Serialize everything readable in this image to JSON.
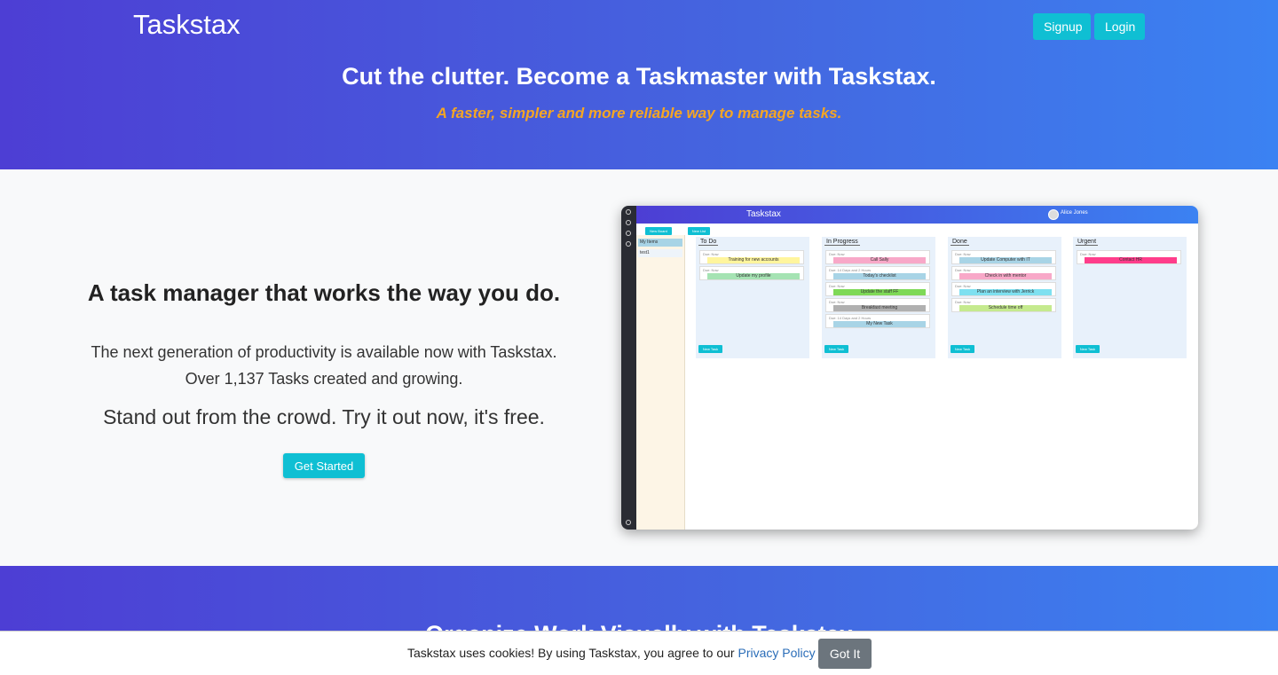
{
  "header": {
    "brand": "Taskstax",
    "signup_label": "Signup",
    "login_label": "Login",
    "title": "Cut the clutter. Become a Taskmaster with Taskstax.",
    "subtitle": "A faster, simpler and more reliable way to manage tasks.",
    "subtitle_color": "#f5a623",
    "accent": "#0fbfd3"
  },
  "feature": {
    "title": "A task manager that works the way you do.",
    "line1": "The next generation of productivity is available now with Taskstax.",
    "line2": "Over 1,137 Tasks created and growing.",
    "line3": "Stand out from the crowd. Try it out now, it's free.",
    "cta_label": "Get Started"
  },
  "preview": {
    "title": "Taskstax",
    "user": "Alice Jones",
    "new_board": "New Board",
    "new_list": "New List",
    "sidebar": [
      "My Items",
      "test1"
    ],
    "columns": [
      {
        "title": "To Do",
        "cards": [
          {
            "due": "Due: Now",
            "text": "Training for new accounts",
            "color": "#fff59d"
          },
          {
            "due": "Due: Now",
            "text": "Update my profile",
            "color": "#a5e3b3"
          }
        ]
      },
      {
        "title": "In Progress",
        "cards": [
          {
            "due": "Due: Now",
            "text": "Call Sally",
            "color": "#f8a8c8"
          },
          {
            "due": "Due: 14 Days and 2 Hours",
            "text": "Today's checklist",
            "color": "#a8d4e6"
          },
          {
            "due": "Due: Now",
            "text": "Update the staff FF",
            "color": "#7ed957"
          },
          {
            "due": "Due: Now",
            "text": "Breakfast meeting",
            "color": "#b0b0b0"
          },
          {
            "due": "Due: 14 Days and 2 Hours",
            "text": "My New Task",
            "color": "#a8d4e6"
          }
        ]
      },
      {
        "title": "Done",
        "cards": [
          {
            "due": "Due: Now",
            "text": "Update Computer with IT",
            "color": "#a8d4e6"
          },
          {
            "due": "Due: Now",
            "text": "Check in with mentor",
            "color": "#f8a8c8"
          },
          {
            "due": "Due: Now",
            "text": "Plan an interview with Jerrick",
            "color": "#7ee0f0"
          },
          {
            "due": "Due: Now",
            "text": "Schedule time off",
            "color": "#c5ea8e"
          }
        ]
      },
      {
        "title": "Urgent",
        "cards": [
          {
            "due": "Due: Now",
            "text": "Contact HR",
            "color": "#ff3d8b"
          }
        ]
      }
    ],
    "new_task": "New Task"
  },
  "band": {
    "title": "Organize Work Visually with Taskstax"
  },
  "cookie": {
    "text": "Taskstax uses cookies! By using Taskstax, you agree to our ",
    "link": "Privacy Policy",
    "button_label": "Got It"
  }
}
